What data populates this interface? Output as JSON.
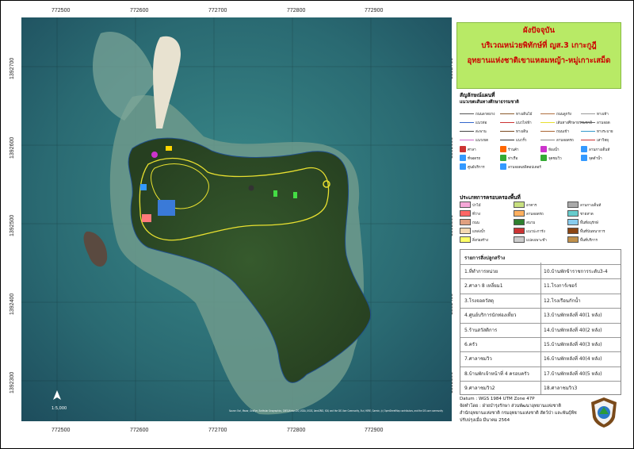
{
  "grid": {
    "x_labels": [
      "772500",
      "772600",
      "772700",
      "772800",
      "772900"
    ],
    "y_labels": [
      "1392700",
      "1392600",
      "1392500",
      "1392400",
      "1392300"
    ]
  },
  "title": {
    "line1": "ผังปัจจุบัน",
    "line2": "บริเวณหน่วยพิทักษ์ที่ ญส.3 เกาะกูฎี",
    "line3": "อุทยานแห่งชาติเขาแหลมหญ้า-หมู่เกาะเสม็ด"
  },
  "legend": {
    "symbols_title": "สัญลักษณ์แผนที่",
    "trail_title": "แนวเขตเส้นทางศึกษาธรรมชาติ",
    "symbols": [
      {
        "label": "ถนนลาดยาง",
        "kind": "line",
        "color": "#555555"
      },
      {
        "label": "ทางเดินไม้",
        "kind": "line",
        "color": "#8b5a2b"
      },
      {
        "label": "ถนนลูกรัง",
        "kind": "line",
        "color": "#b07040"
      },
      {
        "label": "ทางเท้า",
        "kind": "line",
        "color": "#999999"
      },
      {
        "label": "แนวท่อ",
        "kind": "line",
        "color": "#3366cc"
      },
      {
        "label": "แนวไฟฟ้า",
        "kind": "line",
        "color": "#cc3333"
      },
      {
        "label": "เส้นทางศึกษาธรรมชาติ",
        "kind": "line",
        "color": "#e8e030"
      },
      {
        "label": "ลานจอด",
        "kind": "line",
        "color": "#666666"
      },
      {
        "label": "สะพาน",
        "kind": "line",
        "color": "#444444"
      },
      {
        "label": "ทางเดิน",
        "kind": "line",
        "color": "#7a4a20"
      },
      {
        "label": "ถนนเข้า",
        "kind": "line",
        "color": "#aa6633"
      },
      {
        "label": "ทางระบาย",
        "kind": "line",
        "color": "#3399cc"
      },
      {
        "label": "แนวเขต",
        "kind": "line",
        "color": "#cc66cc"
      },
      {
        "label": "แนวรั้ว",
        "kind": "line",
        "color": "#333333"
      },
      {
        "label": "ลานจอดรถ",
        "kind": "line",
        "color": "#888888"
      },
      {
        "label": "เสาวิทยุ",
        "kind": "line",
        "color": "#cc3333"
      },
      {
        "label": "ศาลา",
        "kind": "icon",
        "color": "#cc3333"
      },
      {
        "label": "ร้านค้า",
        "kind": "icon",
        "color": "#ff6600"
      },
      {
        "label": "ห้องน้ำ",
        "kind": "icon",
        "color": "#cc33cc"
      },
      {
        "label": "ลานกางเต็นท์",
        "kind": "icon",
        "color": "#3399ff"
      },
      {
        "label": "ที่จอดรถ",
        "kind": "icon",
        "color": "#3399ff"
      },
      {
        "label": "ท่าเรือ",
        "kind": "icon",
        "color": "#33aa33"
      },
      {
        "label": "จุดชมวิว",
        "kind": "icon",
        "color": "#33aa33"
      },
      {
        "label": "จุดดำน้ำ",
        "kind": "icon",
        "color": "#3399ff"
      },
      {
        "label": "ศูนย์บริการ",
        "kind": "icon",
        "color": "#3399ff"
      },
      {
        "label": "ลานจอดเฮลิคอปเตอร์",
        "kind": "icon",
        "color": "#3399ff"
      }
    ],
    "landuse_title": "ประเภทการครอบครองพื้นที่",
    "landuse": [
      {
        "label": "ป่าไม้",
        "color": "#f6a8d8"
      },
      {
        "label": "อาคาร",
        "color": "#c8e080"
      },
      {
        "label": "ลานกางเต็นท์",
        "color": "#aaaaaa"
      },
      {
        "label": "ที่ว่าง",
        "color": "#ff6666"
      },
      {
        "label": "ลานจอดรถ",
        "color": "#ffb060"
      },
      {
        "label": "ชายหาด",
        "color": "#66cccc"
      },
      {
        "label": "ถนน",
        "color": "#e0a080"
      },
      {
        "label": "สนาม",
        "color": "#2f7f2f"
      },
      {
        "label": "พื้นที่อนุรักษ์",
        "color": "#88ccee"
      },
      {
        "label": "แหล่งน้ำ",
        "color": "#f4d8b0"
      },
      {
        "label": "แนวปะการัง",
        "color": "#cc3333"
      },
      {
        "label": "พื้นที่นันทนาการ",
        "color": "#8b4513"
      },
      {
        "label": "สิ่งก่อสร้าง",
        "color": "#ffff66"
      },
      {
        "label": "แปลงเพาะชำ",
        "color": "#cccccc"
      },
      {
        "label": "พื้นที่บริการ",
        "color": "#c0904a"
      }
    ]
  },
  "buildings": {
    "header": "รายการสิ่งปลูกสร้าง",
    "left": [
      "1.ที่ทำการหน่วย",
      "2.ศาลา 8 เหลี่ยม1",
      "3.โรงจอดวัสดุ",
      "4.ศูนย์บริการนักท่องเที่ยว",
      "5.ร้านสวัสดิการ",
      "6.ครัว",
      "7.ศาลาชมวิว",
      "8.บ้านพักเจ้าหน้าที่ 4 ครอบครัว",
      "9.ศาลาชมวิว2"
    ],
    "right": [
      "10.บ้านพักข้าราชการระดับ3-4",
      "11.โรงการ์เซอร์",
      "12.โรงเรือนกักน้ำ",
      "13.บ้านพักหลังที่ 40(1 หลัง)",
      "14.บ้านพักหลังที่ 40(2 หลัง)",
      "15.บ้านพักหลังที่ 40(3 หลัง)",
      "16.บ้านพักหลังที่ 40(4 หลัง)",
      "17.บ้านพักหลังที่ 40(5 หลัง)",
      "18.ศาลาชมวิว3"
    ]
  },
  "info": {
    "datum": "Datum  :  WGS 1984 UTM Zone 47P",
    "made_by": "จัดทำโดย  :  ฝ่ายบำรุงรักษา ส่วนพัฒนาอุทยานแห่งชาติ",
    "office": "สำนักอุทยานแห่งชาติ  กรมอุทยานแห่งชาติ สัตว์ป่า และพันธุ์พืช",
    "updated": "ปรับปรุงเมื่อ มีนาคม 2564"
  },
  "map": {
    "scale_text": "1:5,000",
    "credit": "Source: Esri, Maxar, GeoEye, Earthstar Geographics, CNES/Airbus DS, USDA, USGS, AeroGRID, IGN, and the GIS User Community, Esri, HERE, Garmin, (c) OpenStreetMap contributors, and the GIS user community"
  },
  "colors": {
    "sea_deep": "#1f4f5f",
    "sea_shallow": "#3a8a8a",
    "reef": "#8fa89a",
    "forest": "#2d4a26",
    "trail": "#e8e030",
    "title_bg": "#b8ea66",
    "title_text": "#cc0000"
  }
}
